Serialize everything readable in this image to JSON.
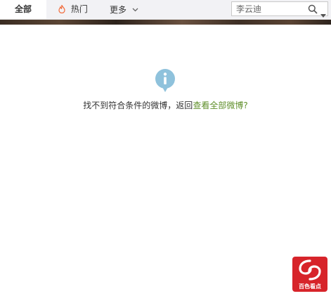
{
  "tabs": {
    "all": "全部",
    "hot": "热门",
    "more": "更多"
  },
  "search": {
    "value": "李云迪",
    "icon": "search-icon"
  },
  "empty_state": {
    "icon": "info-icon",
    "message": "找不到符合条件的微博，返回",
    "link": "查看全部微博?"
  },
  "watermark": {
    "text": "百色看点"
  },
  "colors": {
    "link": "#5f8f2a",
    "info_icon": "#8fc2dc",
    "fire_icon": "#f26b3a",
    "logo_bg": "#d7242a"
  }
}
